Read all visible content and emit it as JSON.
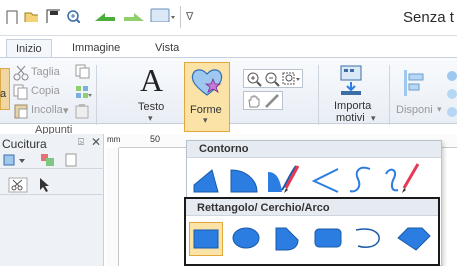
{
  "window": {
    "title": "Senza t"
  },
  "tabs": [
    {
      "label": "Inizio",
      "active": true
    },
    {
      "label": "Immagine",
      "active": false
    },
    {
      "label": "Vista",
      "active": false
    }
  ],
  "ribbon": {
    "clipboard": {
      "cut": "Taglia",
      "copy": "Copia",
      "paste": "Incolla",
      "group": "Appunti"
    },
    "text_label": "Testo",
    "shapes_label": "Forme",
    "import_label_1": "Importa",
    "import_label_2": "motivi",
    "arrange_label": "Disponi",
    "left_partial": "a"
  },
  "panel": {
    "title": "Cucitura",
    "pin": "⍄",
    "close": "✕"
  },
  "ruler": {
    "unit": "mm",
    "tick": "50"
  },
  "gallery": {
    "section1": "Contorno",
    "section2": "Rettangolo/ Cerchio/Arco",
    "outline_shapes": [
      "corner-triangle-icon",
      "half-round-icon",
      "ribbon-pen-icon",
      "less-than-icon",
      "spiral-stroke-icon",
      "freehand-pen-icon"
    ],
    "closed_shapes": [
      "rectangle-icon",
      "ellipse-icon",
      "pentagon-round-icon",
      "rounded-rectangle-icon",
      "arc-icon",
      "rhombus-round-icon"
    ]
  },
  "colors": {
    "accent": "#2b7de1",
    "selected_bg": "#fbe3a8",
    "selected_border": "#e2a93a"
  }
}
